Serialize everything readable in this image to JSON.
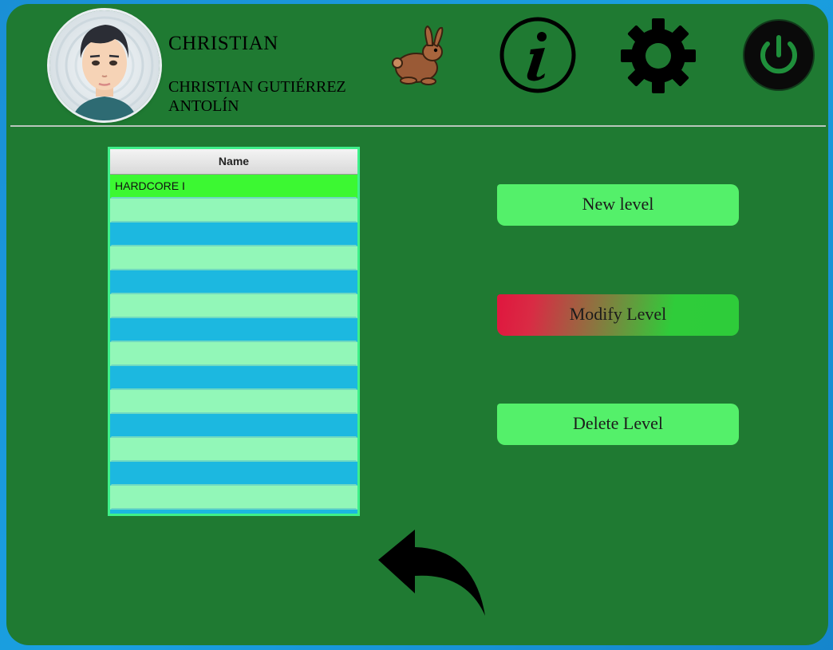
{
  "header": {
    "username": "CHRISTIAN",
    "fullname": "CHRISTIAN GUTIÉRREZ ANTOLÍN",
    "icons": [
      "avatar",
      "rabbit-icon",
      "info-icon",
      "gear-icon",
      "power-icon"
    ]
  },
  "levels_table": {
    "column_header": "Name",
    "rows": [
      "HARDCORE I",
      "",
      "",
      "",
      "",
      "",
      "",
      "",
      "",
      "",
      "",
      "",
      "",
      "",
      ""
    ],
    "selected_index": 0
  },
  "actions": {
    "new_level": "New level",
    "modify_level": "Modify Level",
    "delete_level": "Delete Level"
  },
  "colors": {
    "background": "#1f7a32",
    "accent_green": "#54f06a",
    "row_light": "#92f7b8",
    "row_dark": "#1cb8e0",
    "row_selected": "#3cf832",
    "modify_gradient_start": "#e0163e"
  },
  "navigation": {
    "back_icon": "back-arrow-icon"
  }
}
